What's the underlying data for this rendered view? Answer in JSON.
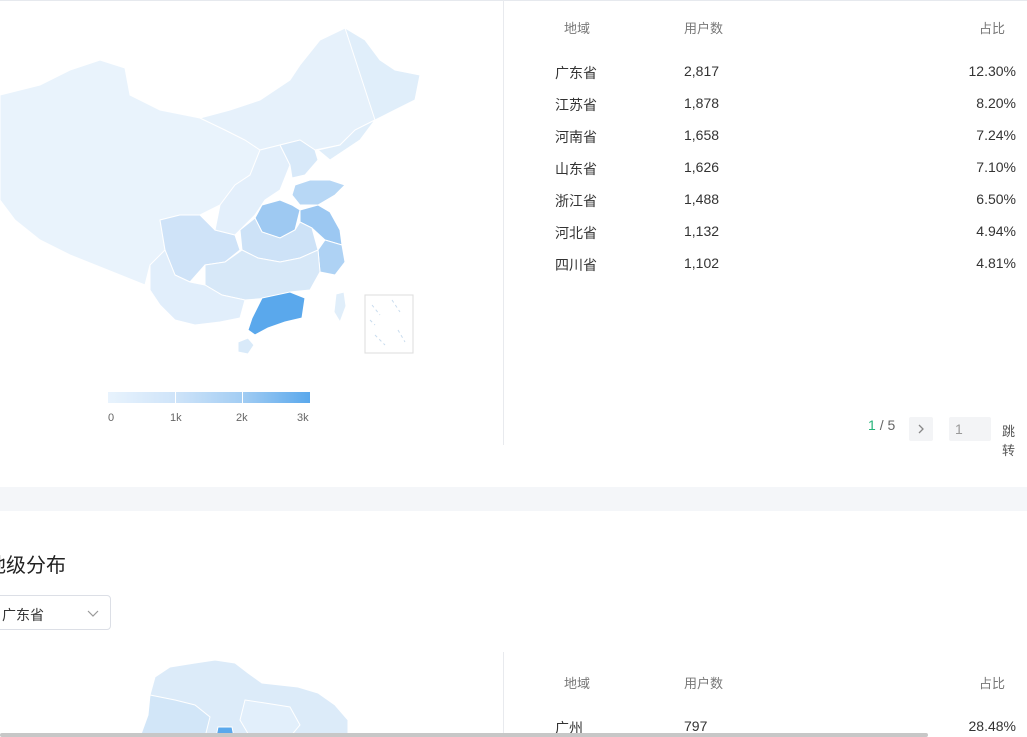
{
  "legend": {
    "labels": [
      "0",
      "1k",
      "2k",
      "3k"
    ]
  },
  "top_table": {
    "headers": {
      "region": "地域",
      "users": "用户数",
      "share": "占比"
    },
    "rows": [
      {
        "region": "广东省",
        "users": "2,817",
        "share": "12.30%"
      },
      {
        "region": "江苏省",
        "users": "1,878",
        "share": "8.20%"
      },
      {
        "region": "河南省",
        "users": "1,658",
        "share": "7.24%"
      },
      {
        "region": "山东省",
        "users": "1,626",
        "share": "7.10%"
      },
      {
        "region": "浙江省",
        "users": "1,488",
        "share": "6.50%"
      },
      {
        "region": "河北省",
        "users": "1,132",
        "share": "4.94%"
      },
      {
        "region": "四川省",
        "users": "1,102",
        "share": "4.81%"
      }
    ]
  },
  "pager": {
    "current": "1",
    "separator": "/",
    "total": "5",
    "next_icon": "chevron-right-icon",
    "jump_value": "1",
    "jump_label": "跳转"
  },
  "city_section": {
    "title": "地级分布",
    "select_value": "广东省",
    "headers": {
      "region": "地域",
      "users": "用户数",
      "share": "占比"
    },
    "rows": [
      {
        "region": "广州",
        "users": "797",
        "share": "28.48%"
      }
    ]
  },
  "colors": {
    "accent_green": "#26b37a",
    "map_dark": "#5aa8ec",
    "map_light": "#e8f3fd"
  }
}
